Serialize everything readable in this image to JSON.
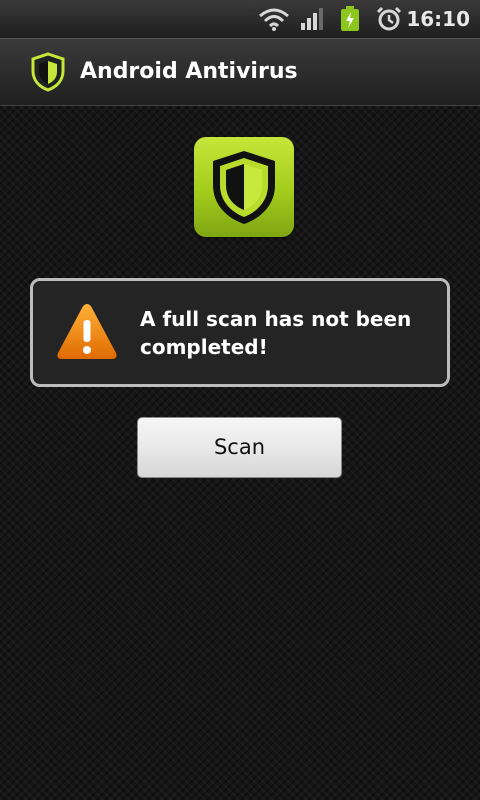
{
  "status_bar": {
    "time": "16:10",
    "icons": [
      "wifi-icon",
      "signal-icon",
      "battery-charging-icon",
      "alarm-icon"
    ],
    "battery_color": "#8cc61e"
  },
  "title_bar": {
    "title": "Android Antivirus",
    "icon": "shield-icon"
  },
  "main": {
    "logo_icon": "shield-icon",
    "warning": {
      "icon": "warning-icon",
      "message": "A full scan has not been completed!"
    },
    "scan_button_label": "Scan"
  },
  "colors": {
    "accent": "#a3cc1c",
    "warning": "#f28a12"
  }
}
